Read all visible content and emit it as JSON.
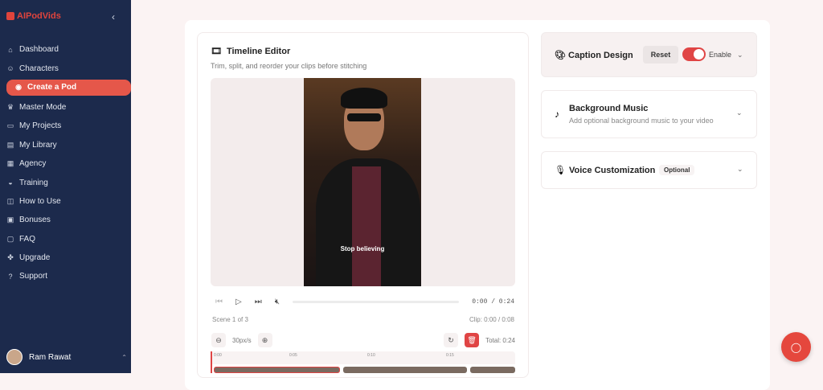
{
  "app": {
    "logo": "AIPodVids",
    "collapse_icon": "chevron-left"
  },
  "sidebar": {
    "items": [
      {
        "label": "Dashboard",
        "icon": "⌂"
      },
      {
        "label": "Characters",
        "icon": "☺"
      },
      {
        "label": "Create a Pod",
        "icon": "◉",
        "active": true
      },
      {
        "label": "Master Mode",
        "icon": "♛"
      },
      {
        "label": "My Projects",
        "icon": "▭"
      },
      {
        "label": "My Library",
        "icon": "▤"
      },
      {
        "label": "Agency",
        "icon": "▦"
      },
      {
        "label": "Training",
        "icon": "◒"
      },
      {
        "label": "How to Use",
        "icon": "◫"
      },
      {
        "label": "Bonuses",
        "icon": "▣"
      },
      {
        "label": "FAQ",
        "icon": "▢"
      },
      {
        "label": "Upgrade",
        "icon": "✤"
      },
      {
        "label": "Support",
        "icon": "?"
      }
    ],
    "user": {
      "name": "Ram Rawat"
    }
  },
  "timeline": {
    "title": "Timeline Editor",
    "subtitle": "Trim, split, and reorder your clips before stitching",
    "caption": "Stop  believing",
    "time": "0:00 / 0:24",
    "scene": "Scene 1 of 3",
    "clip": "Clip: 0:00 / 0:08",
    "zoom": "30px/s",
    "total": "Total: 0:24",
    "ruler": [
      "0:00",
      "0:05",
      "0:10",
      "0:15"
    ]
  },
  "panels": {
    "caption": {
      "title": "Caption Design",
      "reset": "Reset",
      "enable": "Enable",
      "enabled": true
    },
    "music": {
      "title": "Background Music",
      "subtitle": "Add optional background music to your video"
    },
    "voice": {
      "title": "Voice Customization",
      "badge": "Optional"
    }
  },
  "colors": {
    "sidebar": "#1c2a4c",
    "accent": "#e5574a"
  }
}
